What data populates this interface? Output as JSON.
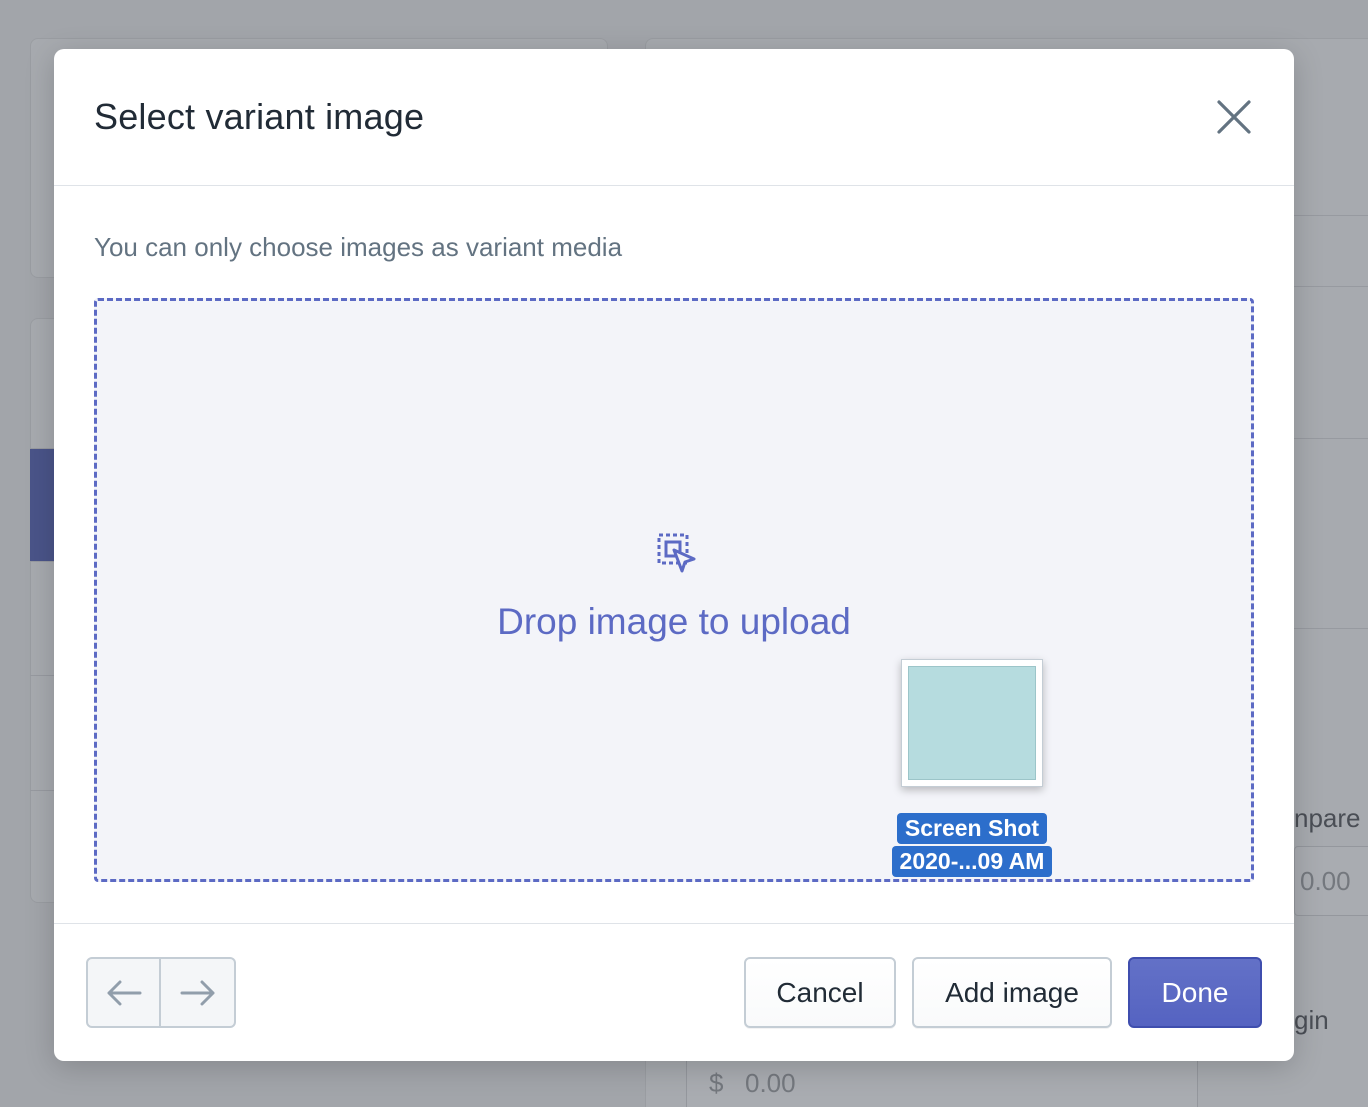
{
  "modal": {
    "title": "Select variant image",
    "helper_text": "You can only choose images as variant media",
    "dropzone_label": "Drop image to upload",
    "dragged_file": {
      "name_line1": "Screen Shot",
      "name_line2": "2020-...09 AM"
    },
    "footer": {
      "cancel_label": "Cancel",
      "add_image_label": "Add image",
      "done_label": "Done"
    },
    "icons": {
      "close": "close-icon",
      "drop": "drop-zone-icon",
      "prev": "arrow-left-icon",
      "next": "arrow-right-icon"
    }
  },
  "background": {
    "compare_label_fragment": "npare a",
    "compare_value": "0.00",
    "margin_fragment": "gin",
    "cost_currency": "$",
    "cost_value": "0.00"
  },
  "colors": {
    "accent": "#5c6ac4",
    "drag_label_bg": "#2c6ecb",
    "overlay": "#a2a5aa"
  }
}
